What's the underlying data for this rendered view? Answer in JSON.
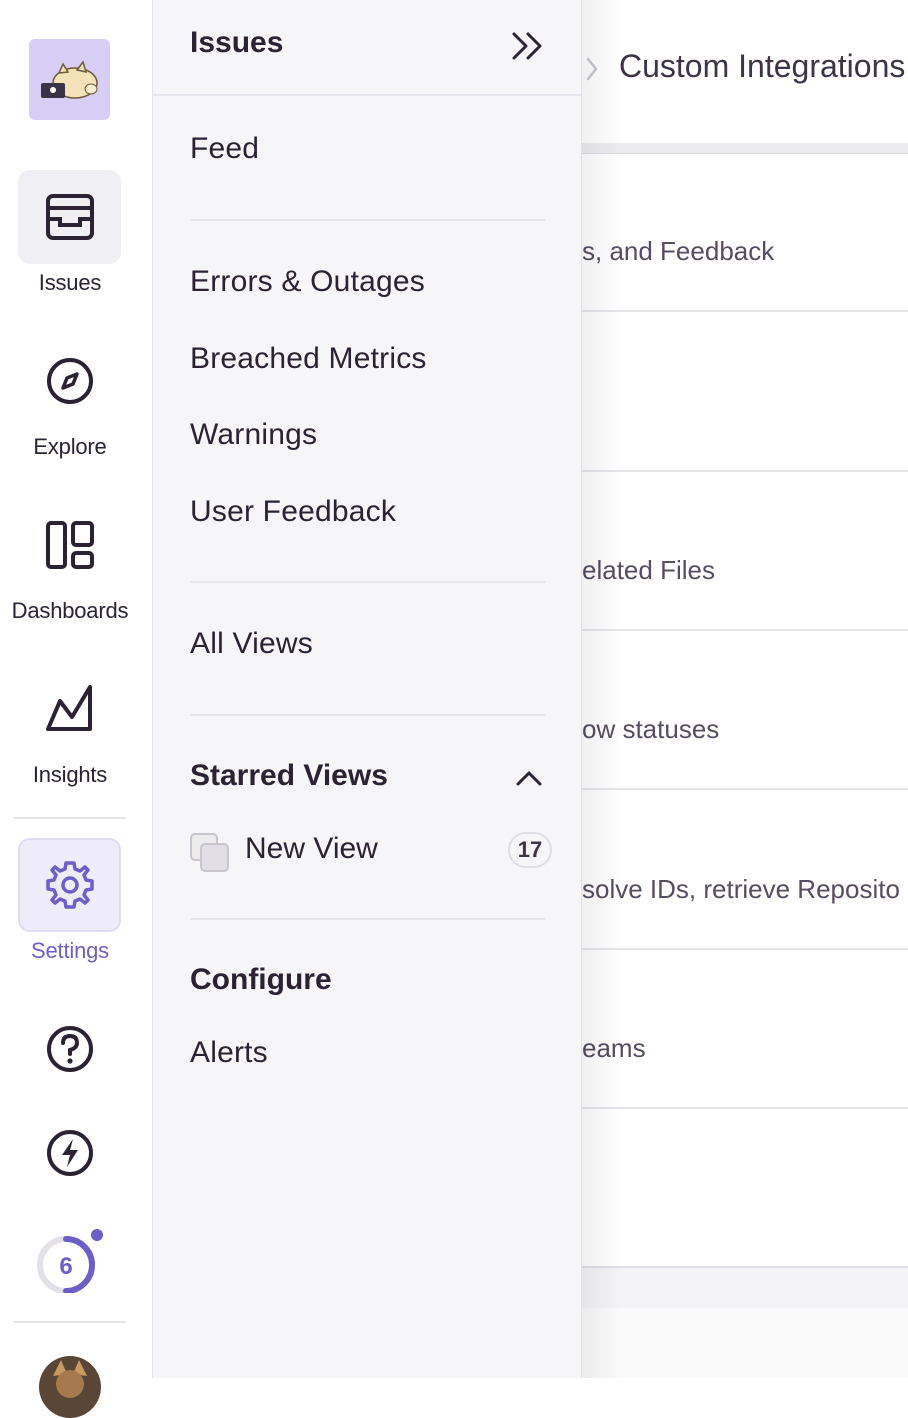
{
  "rail": {
    "items": [
      {
        "label": "Issues",
        "icon": "inbox-icon"
      },
      {
        "label": "Explore",
        "icon": "compass-icon"
      },
      {
        "label": "Dashboards",
        "icon": "dashboard-icon"
      },
      {
        "label": "Insights",
        "icon": "chart-icon"
      },
      {
        "label": "Settings",
        "icon": "gear-icon"
      }
    ],
    "onboarding_count": "6",
    "accent_color": "#6c5fc7"
  },
  "subnav": {
    "title": "Issues",
    "links": [
      "Feed",
      "Errors & Outages",
      "Breached Metrics",
      "Warnings",
      "User Feedback",
      "All Views"
    ],
    "starred_section": "Starred Views",
    "starred_views": [
      {
        "label": "New View",
        "count": "17"
      }
    ],
    "configure_section": "Configure",
    "configure_links": [
      "Alerts"
    ]
  },
  "content": {
    "breadcrumb": "Custom Integrations",
    "rows": [
      "s, and Feedback",
      "",
      "elated Files",
      "ow statuses",
      "solve IDs, retrieve Reposito",
      "eams",
      ""
    ]
  }
}
